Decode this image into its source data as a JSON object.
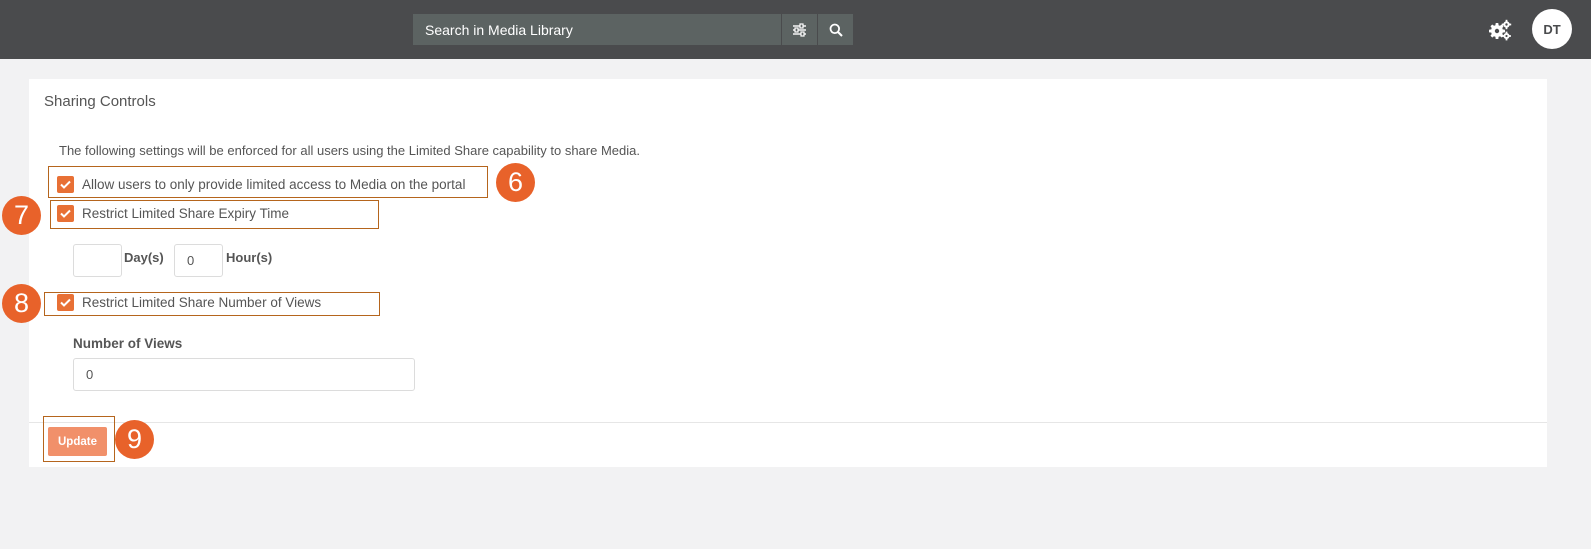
{
  "header": {
    "search_placeholder": "Search in Media Library",
    "avatar_initials": "DT"
  },
  "panel": {
    "title": "Sharing Controls",
    "description": "The following settings will be enforced for all users using the Limited Share capability to share Media.",
    "allow_limited_access": {
      "label": "Allow users to only provide limited access to Media on the portal",
      "checked": true
    },
    "restrict_expiry": {
      "label": "Restrict Limited Share Expiry Time",
      "checked": true
    },
    "expiry": {
      "days_value": "",
      "days_label": "Day(s)",
      "hours_value": "0",
      "hours_label": "Hour(s)"
    },
    "restrict_views": {
      "label": "Restrict Limited Share Number of Views",
      "checked": true
    },
    "views": {
      "label": "Number of Views",
      "value": "0"
    },
    "update_label": "Update"
  },
  "annotations": [
    "6",
    "7",
    "8",
    "9"
  ],
  "colors": {
    "topbar": "#4a4b4d",
    "accent": "#e87035",
    "badge": "#e8622a",
    "button": "#f1906a",
    "background": "#f2f2f3"
  }
}
